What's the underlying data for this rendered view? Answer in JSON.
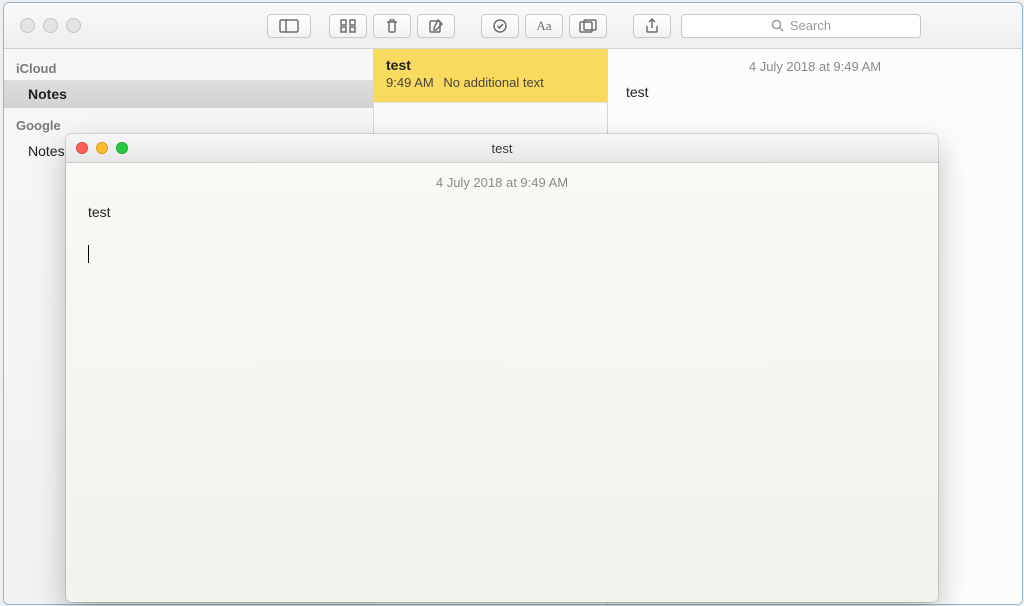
{
  "main_window": {
    "search_placeholder": "Search",
    "sidebar": {
      "sections": [
        {
          "label": "iCloud",
          "items": [
            {
              "label": "Notes",
              "selected": true
            }
          ]
        },
        {
          "label": "Google",
          "items": [
            {
              "label": "Notes",
              "selected": false
            }
          ]
        }
      ]
    },
    "notelist": {
      "items": [
        {
          "title": "test",
          "time": "9:49 AM",
          "snippet": "No additional text",
          "selected": true
        }
      ]
    },
    "editor": {
      "timestamp": "4 July 2018 at 9:49 AM",
      "content": "test"
    }
  },
  "float_window": {
    "title": "test",
    "timestamp": "4 July 2018 at 9:49 AM",
    "content": "test"
  }
}
